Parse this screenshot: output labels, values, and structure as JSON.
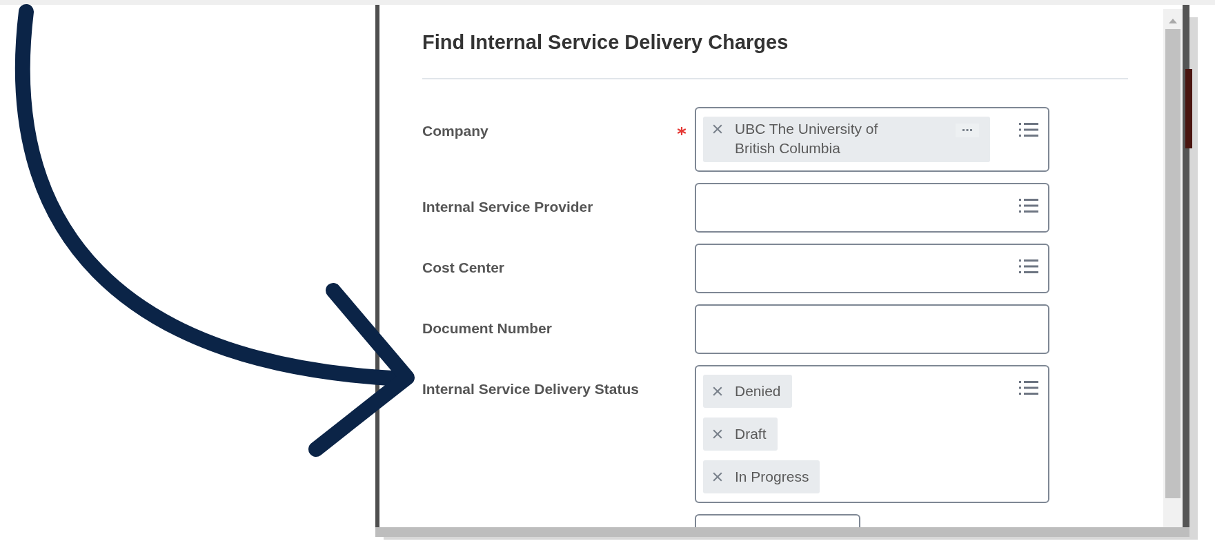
{
  "dialog": {
    "title": "Find Internal Service Delivery Charges",
    "fields": [
      {
        "label": "Company",
        "required": true,
        "kind": "prompt",
        "tags": [
          {
            "text": "UBC The University of British Columbia",
            "more": true
          }
        ]
      },
      {
        "label": "Internal Service Provider",
        "required": false,
        "kind": "prompt"
      },
      {
        "label": "Cost Center",
        "required": false,
        "kind": "prompt"
      },
      {
        "label": "Document Number",
        "required": false,
        "kind": "text"
      },
      {
        "label": "Internal Service Delivery Status",
        "required": false,
        "kind": "prompt",
        "tags": [
          {
            "text": "Denied",
            "more": false
          },
          {
            "text": "Draft",
            "more": false
          },
          {
            "text": "In Progress",
            "more": false
          }
        ]
      },
      {
        "required": false,
        "kind": "short"
      }
    ]
  }
}
